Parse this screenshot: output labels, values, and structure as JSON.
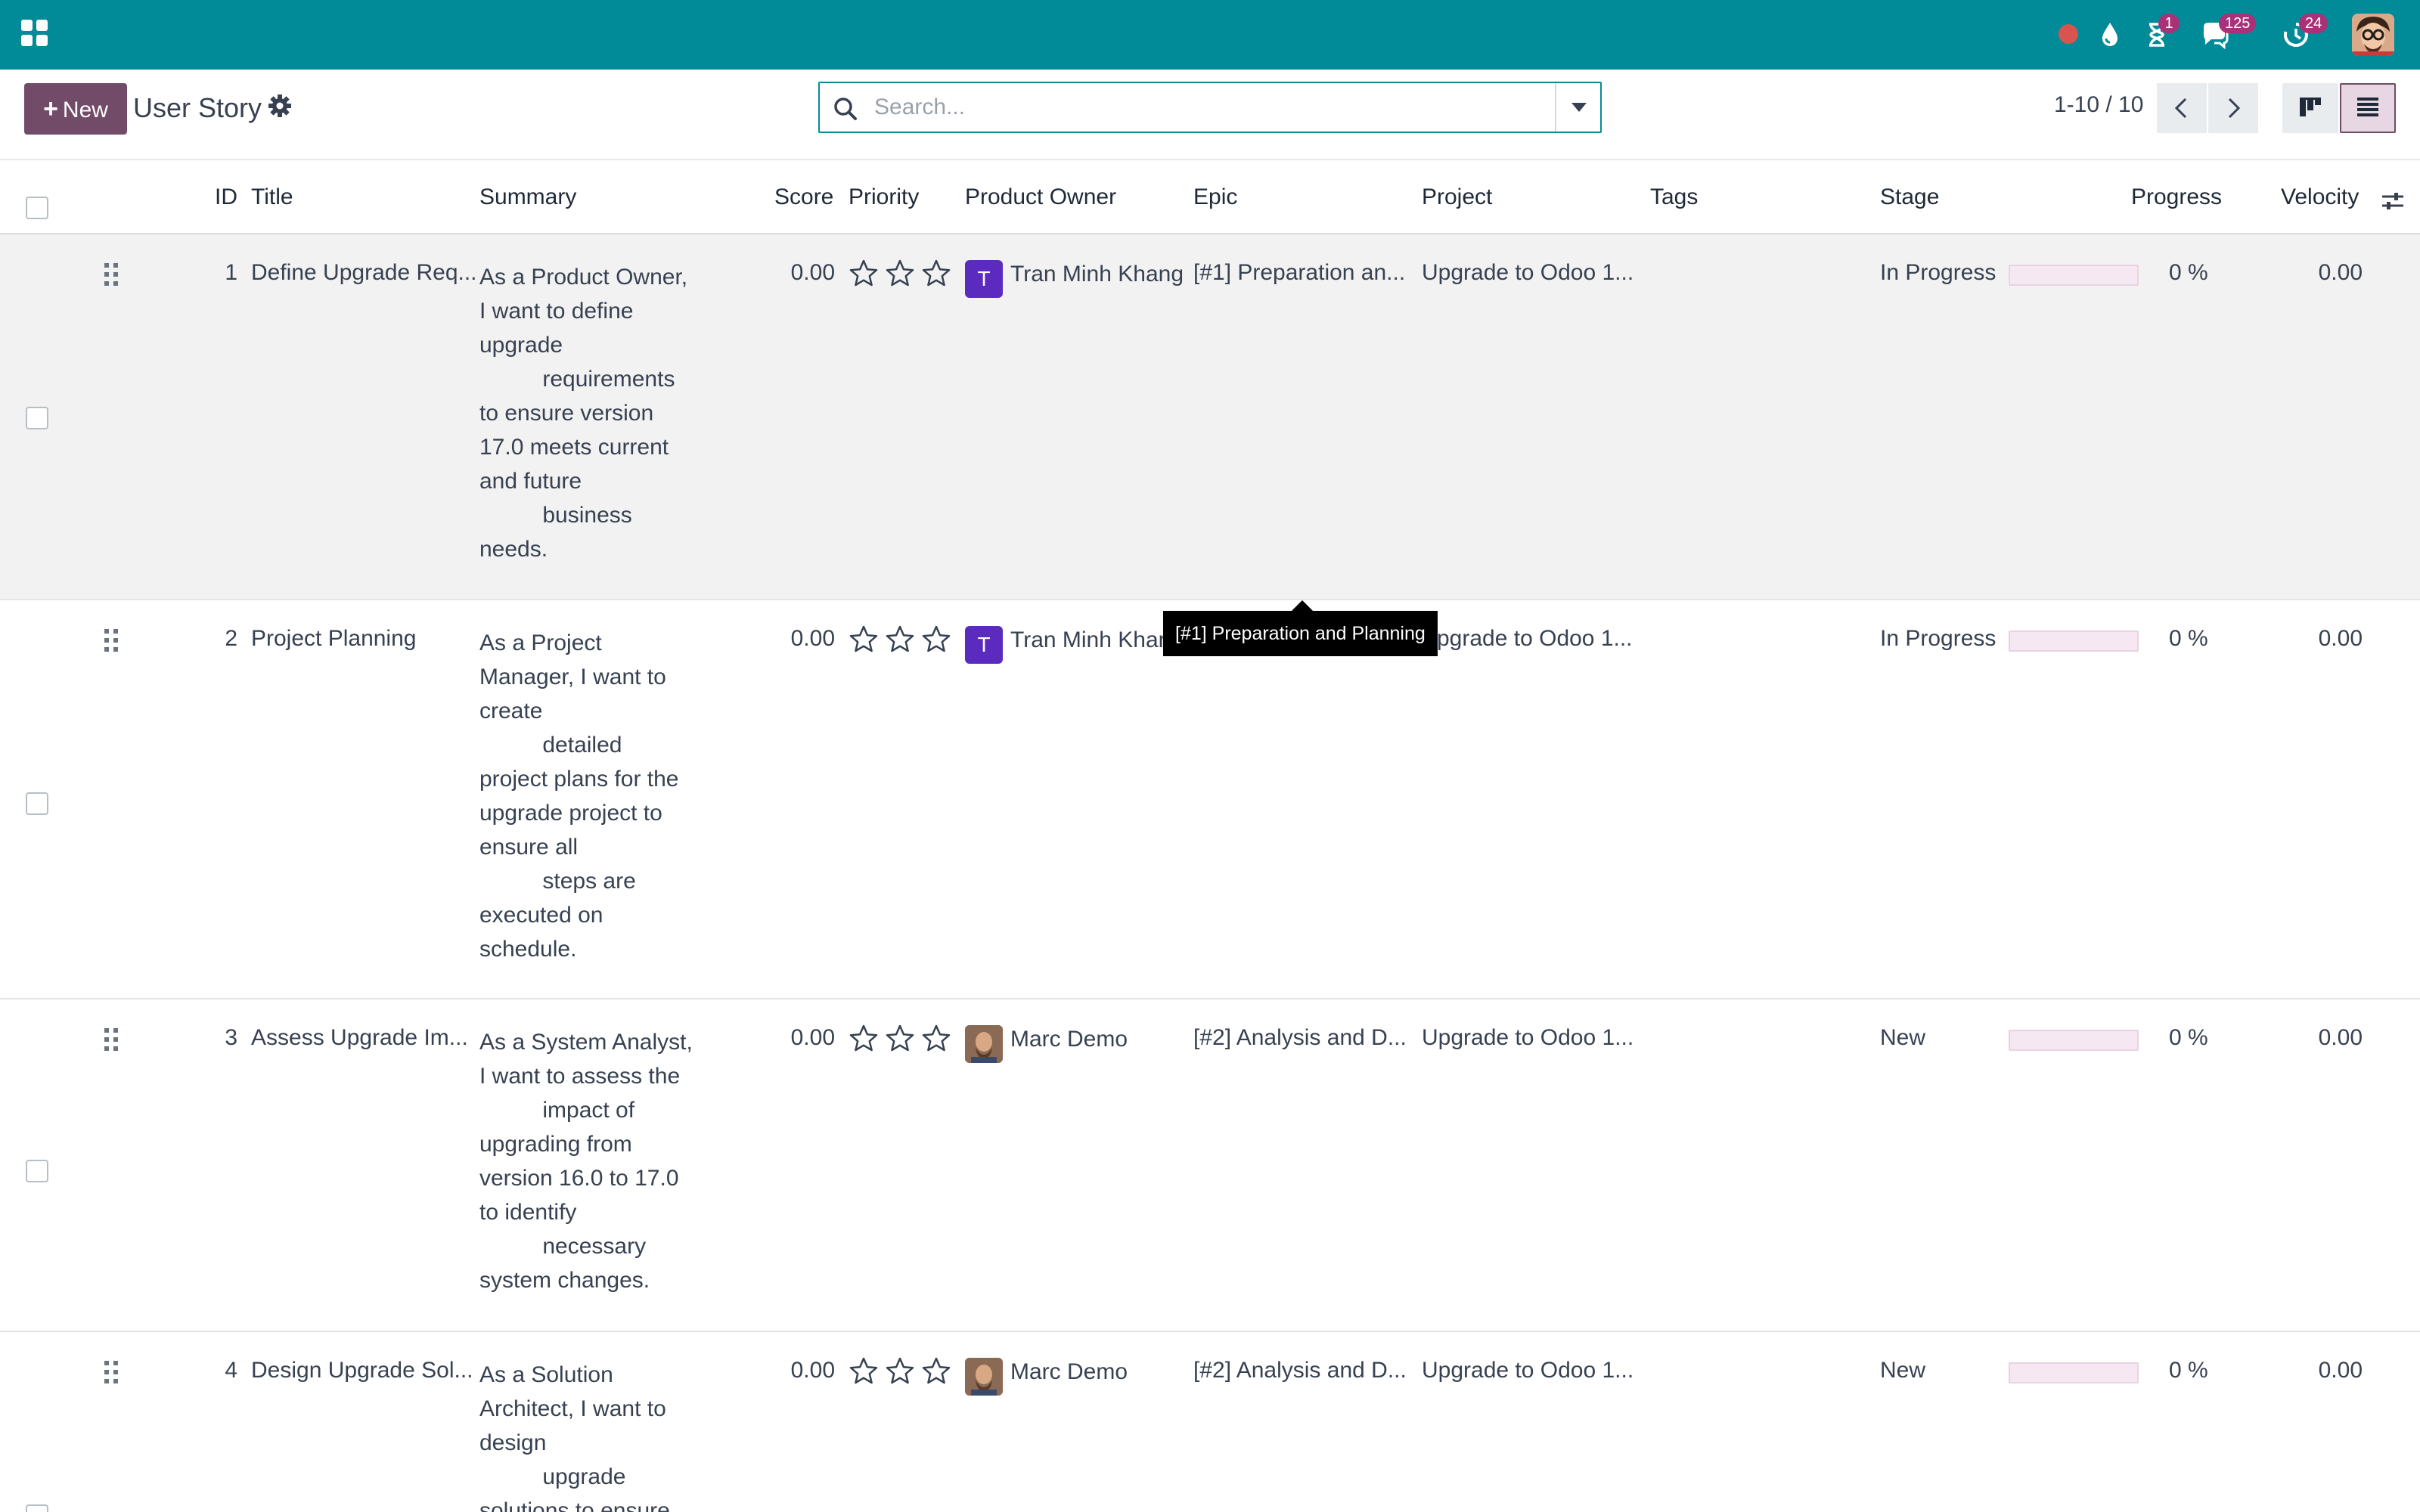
{
  "navbar": {
    "apps_icon": "grid-icon",
    "icons": [
      "record-dot-icon",
      "drop-icon",
      "activity-hourglass-icon",
      "chat-icon",
      "timer-icon"
    ],
    "activity_badge": "1",
    "messages_badge": "125",
    "timer_badge": "24",
    "colors": {
      "navbar": "#018a98",
      "badge": "#a83278",
      "brand": "#714b67"
    }
  },
  "control_panel": {
    "new_button": "New",
    "title": "User Story",
    "search_placeholder": "Search...",
    "pager": "1-10 / 10"
  },
  "table": {
    "columns": {
      "id": "ID",
      "title": "Title",
      "summary": "Summary",
      "score": "Score",
      "priority": "Priority",
      "owner": "Product Owner",
      "epic": "Epic",
      "project": "Project",
      "tags": "Tags",
      "stage": "Stage",
      "progress": "Progress",
      "velocity": "Velocity"
    },
    "rows": [
      {
        "id": "1",
        "title": "Define Upgrade Req...",
        "summary": "As a Product Owner,\nI want to define\nupgrade\n          requirements\nto ensure version\n17.0 meets current\nand future\n          business\nneeds.",
        "score": "0.00",
        "priority_stars": 0,
        "owner_initial": "T",
        "owner": "Tran Minh Khang",
        "epic": "[#1] Preparation an...",
        "project": "Upgrade to Odoo 1...",
        "tags": "",
        "stage": "In Progress",
        "progress": 0,
        "progress_label": "0 %",
        "velocity": "0.00"
      },
      {
        "id": "2",
        "title": "Project Planning",
        "summary": "As a Project\nManager, I want to\ncreate\n          detailed\nproject plans for the\nupgrade project to\nensure all\n          steps are\nexecuted on\nschedule.",
        "score": "0.00",
        "priority_stars": 0,
        "owner_initial": "T",
        "owner": "Tran Minh Khar",
        "epic": "",
        "project": "pgrade to Odoo 1...",
        "tags": "",
        "stage": "In Progress",
        "progress": 0,
        "progress_label": "0 %",
        "velocity": "0.00"
      },
      {
        "id": "3",
        "title": "Assess Upgrade Im...",
        "summary": "As a System Analyst,\nI want to assess the\n          impact of\nupgrading from\nversion 16.0 to 17.0\nto identify\n          necessary\nsystem changes.",
        "score": "0.00",
        "priority_stars": 0,
        "owner_initial": "",
        "owner": "Marc Demo",
        "epic": "[#2] Analysis and D...",
        "project": "Upgrade to Odoo 1...",
        "tags": "",
        "stage": "New",
        "progress": 0,
        "progress_label": "0 %",
        "velocity": "0.00"
      },
      {
        "id": "4",
        "title": "Design Upgrade Sol...",
        "summary": "As a Solution\nArchitect, I want to\ndesign\n          upgrade\nsolutions to ensure",
        "score": "0.00",
        "priority_stars": 0,
        "owner_initial": "",
        "owner": "Marc Demo",
        "epic": "[#2] Analysis and D...",
        "project": "Upgrade to Odoo 1...",
        "tags": "",
        "stage": "New",
        "progress": 0,
        "progress_label": "0 %",
        "velocity": "0.00"
      }
    ]
  },
  "tooltip": {
    "text": "[#1] Preparation and Planning"
  }
}
